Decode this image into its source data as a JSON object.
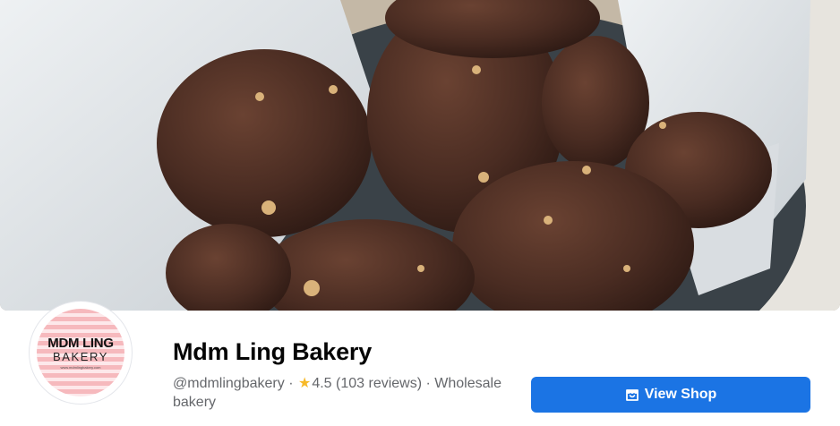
{
  "cover": {
    "alt_icon": "cover-photo-chocolate-cookies"
  },
  "avatar": {
    "logo_line1": "MDM LING",
    "logo_line2": "BAKERY",
    "logo_url": "www.mdmlingbakery.com"
  },
  "page": {
    "name": "Mdm Ling Bakery",
    "handle": "@mdmlingbakery",
    "separator": "·",
    "rating": "4.5",
    "reviews": "(103 reviews)",
    "category": "Wholesale bakery"
  },
  "actions": {
    "view_shop_label": "View Shop",
    "view_shop_icon": "shop-icon"
  },
  "colors": {
    "button": "#1b74e4",
    "star": "#f7b928",
    "secondary_text": "#65676b"
  }
}
